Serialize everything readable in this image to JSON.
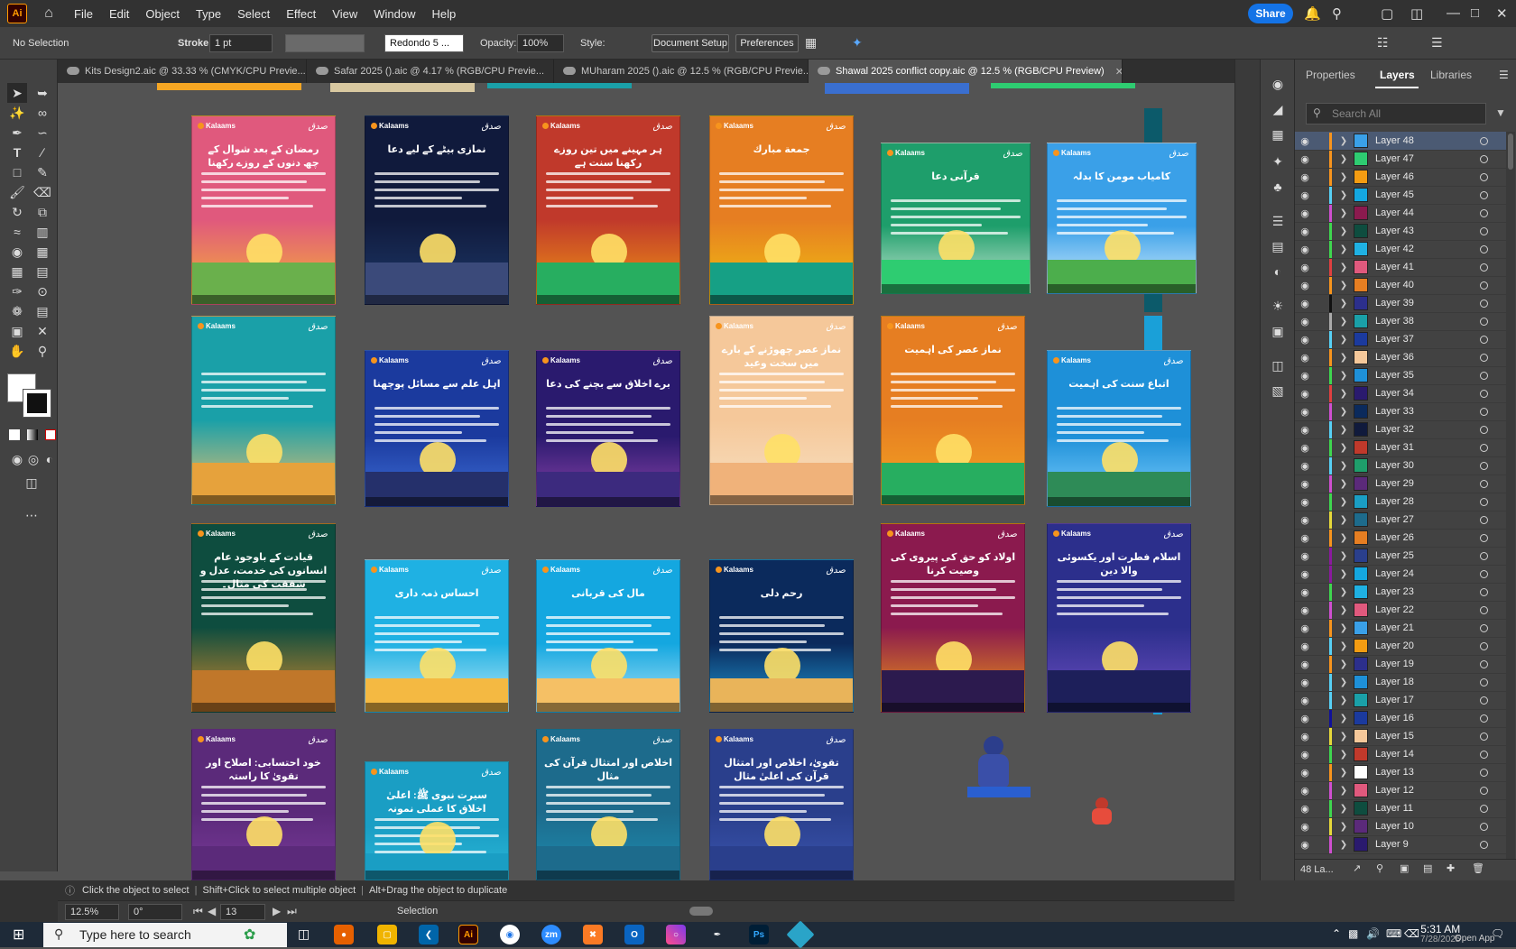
{
  "menubar": {
    "logo": "Ai",
    "items": [
      "File",
      "Edit",
      "Object",
      "Type",
      "Select",
      "Effect",
      "View",
      "Window",
      "Help"
    ],
    "share_label": "Share"
  },
  "controlbar": {
    "selection": "No Selection",
    "stroke_label": "Stroke:",
    "stroke_value": "1 pt",
    "brush_value": "Redondo 5 ...",
    "opacity_label": "Opacity:",
    "opacity_value": "100%",
    "style_label": "Style:",
    "document_setup": "Document Setup",
    "preferences": "Preferences"
  },
  "tabs": [
    {
      "label": "Kits Design2.aic @ 33.33 % (CMYK/CPU Previe...",
      "active": false
    },
    {
      "label": "Safar 2025 ().aic @ 4.17 % (RGB/CPU Previe...",
      "active": false
    },
    {
      "label": "MUharam 2025 ().aic @ 12.5 % (RGB/CPU Previe...",
      "active": false
    },
    {
      "label": "Shawal 2025 conflict copy.aic @ 12.5 % (RGB/CPU Preview)",
      "active": true
    }
  ],
  "artboards": [
    {
      "title": "رمضان کے بعد شوال کے چھ دنوں کے روزے رکھنا",
      "brand": "Kalaams",
      "bg": "#e0597d",
      "bg2": "#f7b731",
      "ground": "#6ab04c"
    },
    {
      "title": "نمازی بیٹے کے لیے دعا",
      "brand": "Kalaams",
      "bg": "#101a3c",
      "bg2": "#1e3a6b",
      "ground": "#3b4a7a"
    },
    {
      "title": "ہر مہینے میں تین روزے رکھنا سنت ہے",
      "brand": "Kalaams",
      "bg": "#c0392b",
      "bg2": "#f39c12",
      "ground": "#27ae60"
    },
    {
      "title": "جمعة مبارك",
      "brand": "Kalaams",
      "bg": "#e67e22",
      "bg2": "#f1c40f",
      "ground": "#16a085"
    },
    {
      "title": "قرآنی دعا",
      "brand": "Kalaams",
      "bg": "#1e9e6b",
      "bg2": "#cdebd6",
      "ground": "#2ecc71"
    },
    {
      "title": "کامیاب مومن کا بدلہ",
      "brand": "Kalaams",
      "bg": "#3aa0e8",
      "bg2": "#d8f0ff",
      "ground": "#4cae4c"
    },
    {
      "title": "",
      "brand": "Kalaams",
      "bg": "#1aa0a8",
      "bg2": "#f5c16c",
      "ground": "#e6a23c"
    },
    {
      "title": "اہل علم سے مسائل پوچھنا",
      "brand": "Kalaams",
      "bg": "#1b3a9e",
      "bg2": "#3f6fd8",
      "ground": "#25306b"
    },
    {
      "title": "برے اخلاق سے بچنے کی دعا",
      "brand": "Kalaams",
      "bg": "#2a1a6e",
      "bg2": "#8e44ad",
      "ground": "#3c2a7e"
    },
    {
      "title": "نماز عصر چھوڑنے کے بارے میں سخت وعید",
      "brand": "Kalaams",
      "bg": "#f5c89a",
      "bg2": "#f8e1c3",
      "ground": "#f0b27a"
    },
    {
      "title": "نماز عصر کی اہمیت",
      "brand": "Kalaams",
      "bg": "#e67e22",
      "bg2": "#f5a623",
      "ground": "#27ae60"
    },
    {
      "title": "اتباع سنت کی اہمیت",
      "brand": "Kalaams",
      "bg": "#1e90d8",
      "bg2": "#7fd0ff",
      "ground": "#2e8b57"
    },
    {
      "title": "قیادت کے باوجود عام انسانوں کی خدمت، عدل و شفقت کی مثال۔",
      "brand": "Kalaams",
      "bg": "#0e4d3f",
      "bg2": "#d98c2b",
      "ground": "#c0772a"
    },
    {
      "title": "احساس ذمہ داری",
      "brand": "Kalaams",
      "bg": "#1fb1e3",
      "bg2": "#bfe9f7",
      "ground": "#f4b942"
    },
    {
      "title": "مال کی قربانی",
      "brand": "Kalaams",
      "bg": "#14a7e0",
      "bg2": "#aee4f7",
      "ground": "#f5c065"
    },
    {
      "title": "رحم دلی",
      "brand": "Kalaams",
      "bg": "#0b2a5c",
      "bg2": "#1f9bd6",
      "ground": "#e9b45a"
    },
    {
      "title": "اولاد کو حق کی پیروی کی وصیت کرنا",
      "brand": "Kalaams",
      "bg": "#8b1a4e",
      "bg2": "#f39c12",
      "ground": "#2c1a4e"
    },
    {
      "title": "اسلام فطرت اور یکسوئی والا دین",
      "brand": "Kalaams",
      "bg": "#2c2f8c",
      "bg2": "#6f4fc4",
      "ground": "#1d1f5a"
    },
    {
      "title": "خود احتسابی: اصلاح اور تقویٰ کا راستہ",
      "brand": "Kalaams",
      "bg": "#5b2a7a",
      "bg2": "#7a3a9a",
      "ground": "#5b2a7a"
    },
    {
      "title": "سیرت نبوی ﷺ: اعلیٰ اخلاق کا عملی نمونہ",
      "brand": "Kalaams",
      "bg": "#1a9ec4",
      "bg2": "#2bb7d8",
      "ground": "#1a9ec4"
    },
    {
      "title": "اخلاص اور امتثال قرآن کی مثال",
      "brand": "Kalaams",
      "bg": "#1d6b8c",
      "bg2": "#1d8cb0",
      "ground": "#1d6b8c"
    },
    {
      "title": "تقویٰ، اخلاص اور امتثال قرآن کی اعلیٰ مثال",
      "brand": "Kalaams",
      "bg": "#2a3f8c",
      "bg2": "#3b55b0",
      "ground": "#2a3f8c"
    }
  ],
  "right_panel": {
    "tabs": [
      "Properties",
      "Layers",
      "Libraries"
    ],
    "search_placeholder": "Search All",
    "layers": [
      {
        "name": "Layer 48",
        "color": "#f7941d",
        "thumb": "#3aa0e8",
        "selected": true
      },
      {
        "name": "Layer 47",
        "color": "#f7941d",
        "thumb": "#2ecc71"
      },
      {
        "name": "Layer 46",
        "color": "#f7941d",
        "thumb": "#f39c12"
      },
      {
        "name": "Layer 45",
        "color": "#57d0f5",
        "thumb": "#14a7e0"
      },
      {
        "name": "Layer 44",
        "color": "#cf4fd0",
        "thumb": "#8b1a4e"
      },
      {
        "name": "Layer 43",
        "color": "#3fd64f",
        "thumb": "#0e4d3f"
      },
      {
        "name": "Layer 42",
        "color": "#3fd64f",
        "thumb": "#1fb1e3"
      },
      {
        "name": "Layer 41",
        "color": "#e04040",
        "thumb": "#e0597d"
      },
      {
        "name": "Layer 40",
        "color": "#f7941d",
        "thumb": "#e67e22"
      },
      {
        "name": "Layer 39",
        "color": "#111111",
        "thumb": "#2c2f8c"
      },
      {
        "name": "Layer 38",
        "color": "#aaaaaa",
        "thumb": "#1aa0a8"
      },
      {
        "name": "Layer 37",
        "color": "#57d0f5",
        "thumb": "#1b3a9e"
      },
      {
        "name": "Layer 36",
        "color": "#f7941d",
        "thumb": "#f5c89a"
      },
      {
        "name": "Layer 35",
        "color": "#3fd64f",
        "thumb": "#1e90d8"
      },
      {
        "name": "Layer 34",
        "color": "#e04040",
        "thumb": "#2a1a6e"
      },
      {
        "name": "Layer 33",
        "color": "#cf4fd0",
        "thumb": "#0b2a5c"
      },
      {
        "name": "Layer 32",
        "color": "#57d0f5",
        "thumb": "#101a3c"
      },
      {
        "name": "Layer 31",
        "color": "#3fd64f",
        "thumb": "#c0392b"
      },
      {
        "name": "Layer 30",
        "color": "#57d0f5",
        "thumb": "#1e9e6b"
      },
      {
        "name": "Layer 29",
        "color": "#cf4fd0",
        "thumb": "#5b2a7a"
      },
      {
        "name": "Layer 28",
        "color": "#3fd64f",
        "thumb": "#1a9ec4"
      },
      {
        "name": "Layer 27",
        "color": "#e6d83a",
        "thumb": "#1d6b8c"
      },
      {
        "name": "Layer 26",
        "color": "#f7941d",
        "thumb": "#e67e22"
      },
      {
        "name": "Layer 25",
        "color": "#8b1a9e",
        "thumb": "#2a3f8c"
      },
      {
        "name": "Layer 24",
        "color": "#8b1a9e",
        "thumb": "#14a7e0"
      },
      {
        "name": "Layer 23",
        "color": "#3fd64f",
        "thumb": "#1fb1e3"
      },
      {
        "name": "Layer 22",
        "color": "#cf4fd0",
        "thumb": "#e0597d"
      },
      {
        "name": "Layer 21",
        "color": "#f7941d",
        "thumb": "#3aa0e8"
      },
      {
        "name": "Layer 20",
        "color": "#57d0f5",
        "thumb": "#f39c12"
      },
      {
        "name": "Layer 19",
        "color": "#f7941d",
        "thumb": "#2c2f8c"
      },
      {
        "name": "Layer 18",
        "color": "#57d0f5",
        "thumb": "#1e90d8"
      },
      {
        "name": "Layer 17",
        "color": "#57d0f5",
        "thumb": "#1aa0a8"
      },
      {
        "name": "Layer 16",
        "color": "#111199",
        "thumb": "#1b3a9e"
      },
      {
        "name": "Layer 15",
        "color": "#e6d83a",
        "thumb": "#f5c89a"
      },
      {
        "name": "Layer 14",
        "color": "#3fd64f",
        "thumb": "#c0392b"
      },
      {
        "name": "Layer 13",
        "color": "#f7941d",
        "thumb": "#ffffff"
      },
      {
        "name": "Layer 12",
        "color": "#cf4fd0",
        "thumb": "#e0597d"
      },
      {
        "name": "Layer 11",
        "color": "#3fd64f",
        "thumb": "#0e4d3f"
      },
      {
        "name": "Layer 10",
        "color": "#e6d83a",
        "thumb": "#5b2a7a"
      },
      {
        "name": "Layer 9",
        "color": "#cf4fd0",
        "thumb": "#2a1a6e"
      }
    ],
    "footer_count": "48 La..."
  },
  "status": {
    "hint1": "Click the object to select",
    "hint2": "Shift+Click to select multiple object",
    "hint3": "Alt+Drag the object to duplicate",
    "zoom": "12.5%",
    "rotation": "0°",
    "artboard_num": "13",
    "tool": "Selection"
  },
  "taskbar": {
    "search_placeholder": "Type here to search",
    "time": "5:31 AM",
    "date": "7/28/2025",
    "open_app": "Open App"
  }
}
